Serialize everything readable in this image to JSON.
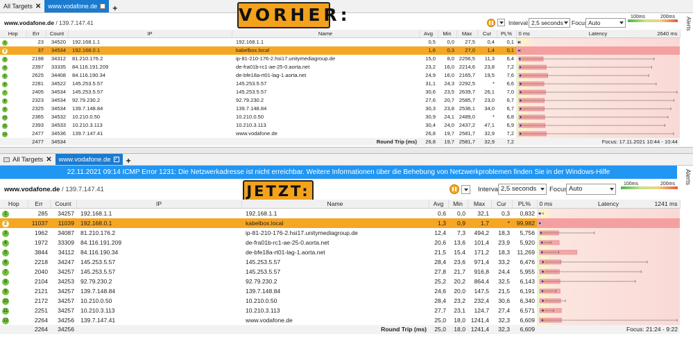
{
  "tabs": {
    "all_targets": "All Targets",
    "active": "www.vodafone.de"
  },
  "colors": {
    "accent": "#1a7bd0",
    "highlight": "#f5a623",
    "banner": "#f2a21c",
    "error_bar": "#2196f3",
    "hop_badge": "#76c043"
  },
  "panels": [
    {
      "banner": "VORHER:",
      "target_name": "www.vodafone.de",
      "target_ip": " / 139.7.147.41",
      "interval_label": "Interval",
      "interval_value": "2,5 seconds",
      "focus_label": "Focus",
      "focus_value": "Auto",
      "legend_100": "100ms",
      "legend_200": "200ms",
      "alerts_label": "Alerts",
      "headers": {
        "hop": "Hop",
        "err": "Err",
        "count": "Count",
        "ip": "IP",
        "name": "Name",
        "avg": "Avg",
        "min": "Min",
        "max": "Max",
        "cur": "Cur",
        "pl": "PL%",
        "zero": "0 ms",
        "latency": "Latency",
        "scale": "2640 ms"
      },
      "rows": [
        {
          "hop": "1",
          "err": "23",
          "count": "34520",
          "ip": "192.168.1.1",
          "name": "192.168.1.1",
          "avg": "0,5",
          "min": "0,0",
          "max": "27,5",
          "cur": "0,4",
          "pl": "0,1"
        },
        {
          "hop": "2",
          "err": "37",
          "count": "34534",
          "ip": "192.168.0.1",
          "name": "kabelbox.local",
          "avg": "1,6",
          "min": "0,3",
          "max": "27,0",
          "cur": "1,4",
          "pl": "0,1"
        },
        {
          "hop": "3",
          "err": "2198",
          "count": "34312",
          "ip": "81.210.176.2",
          "name": "ip-81-210-176-2.hsi17.unitymediagroup.de",
          "avg": "15,0",
          "min": "8,0",
          "max": "2256,5",
          "cur": "11,3",
          "pl": "6,4"
        },
        {
          "hop": "4",
          "err": "2397",
          "count": "33335",
          "ip": "84.116.191.209",
          "name": "de-fra01b-rc1-ae-25-0.aorta.net",
          "avg": "23,2",
          "min": "16,0",
          "max": "2214,6",
          "cur": "23,8",
          "pl": "7,2"
        },
        {
          "hop": "5",
          "err": "2625",
          "count": "34408",
          "ip": "84.116.190.34",
          "name": "de-bfe18a-rt01-lag-1.aorta.net",
          "avg": "24,9",
          "min": "16,0",
          "max": "2165,7",
          "cur": "19,5",
          "pl": "7,6"
        },
        {
          "hop": "6",
          "err": "2281",
          "count": "34522",
          "ip": "145.253.5.57",
          "name": "145.253.5.57",
          "avg": "31,1",
          "min": "24,3",
          "max": "2292,5",
          "cur": "*",
          "pl": "6,6"
        },
        {
          "hop": "7",
          "err": "2405",
          "count": "34534",
          "ip": "145.253.5.57",
          "name": "145.253.5.57",
          "avg": "30,6",
          "min": "23,5",
          "max": "2639,7",
          "cur": "26,1",
          "pl": "7,0"
        },
        {
          "hop": "8",
          "err": "2323",
          "count": "34534",
          "ip": "92.79.230.2",
          "name": "92.79.230.2",
          "avg": "27,6",
          "min": "20,7",
          "max": "2585,7",
          "cur": "23,0",
          "pl": "6,7"
        },
        {
          "hop": "9",
          "err": "2325",
          "count": "34534",
          "ip": "139.7.148.84",
          "name": "139.7.148.84",
          "avg": "30,3",
          "min": "23,8",
          "max": "2536,1",
          "cur": "34,0",
          "pl": "6,7"
        },
        {
          "hop": "10",
          "err": "2365",
          "count": "34532",
          "ip": "10.210.0.50",
          "name": "10.210.0.50",
          "avg": "30,9",
          "min": "24,1",
          "max": "2489,0",
          "cur": "*",
          "pl": "6,8"
        },
        {
          "hop": "11",
          "err": "2393",
          "count": "34533",
          "ip": "10.210.3.113",
          "name": "10.210.3.113",
          "avg": "30,4",
          "min": "24,0",
          "max": "2437,2",
          "cur": "47,1",
          "pl": "6,9"
        },
        {
          "hop": "12",
          "err": "2477",
          "count": "34536",
          "ip": "139.7.147.41",
          "name": "www.vodafone.de",
          "avg": "26,8",
          "min": "19,7",
          "max": "2581,7",
          "cur": "32,9",
          "pl": "7,2"
        }
      ],
      "total": {
        "err": "2477",
        "count": "34534",
        "label": "Round Trip (ms)",
        "avg": "26,8",
        "min": "19,7",
        "max": "2581,7",
        "cur": "32,9",
        "pl": "7,2",
        "focus": "Focus: 17.11.2021 10:44 - 10:44"
      }
    },
    {
      "banner": "JETZT:",
      "error_message": "22.11.2021 09:14 ICMP Error 1231: Die Netzwerkadresse ist nicht erreichbar. Weitere Informationen über die Behebung von Netzwerkproblemen finden Sie in der Windows-Hilfe",
      "target_name": "www.vodafone.de",
      "target_ip": " / 139.7.147.41",
      "interval_label": "Interval",
      "interval_value": "2,5 seconds",
      "focus_label": "Focus",
      "focus_value": "Auto",
      "legend_100": "100ms",
      "legend_200": "200ms",
      "alerts_label": "Alerts",
      "headers": {
        "hop": "Hop",
        "err": "Err",
        "count": "Count",
        "ip": "IP",
        "name": "Name",
        "avg": "Avg",
        "min": "Min",
        "max": "Max",
        "cur": "Cur",
        "pl": "PL%",
        "zero": "0 ms",
        "latency": "Latency",
        "scale": "1241 ms"
      },
      "rows": [
        {
          "hop": "1",
          "err": "285",
          "count": "34257",
          "ip": "192.168.1.1",
          "name": "192.168.1.1",
          "avg": "0,6",
          "min": "0,0",
          "max": "32,1",
          "cur": "0,3",
          "pl": "0,832"
        },
        {
          "hop": "2",
          "err": "11037",
          "count": "11039",
          "ip": "192.168.0.1",
          "name": "kabelbox.local",
          "avg": "1,3",
          "min": "0,9",
          "max": "1,7",
          "cur": "*",
          "pl": "99,982"
        },
        {
          "hop": "3",
          "err": "1962",
          "count": "34087",
          "ip": "81.210.176.2",
          "name": "ip-81-210-176-2.hsi17.unitymediagroup.de",
          "avg": "12,4",
          "min": "7,3",
          "max": "494,2",
          "cur": "18,3",
          "pl": "5,756"
        },
        {
          "hop": "4",
          "err": "1972",
          "count": "33309",
          "ip": "84.116.191.209",
          "name": "de-fra01b-rc1-ae-25-0.aorta.net",
          "avg": "20,6",
          "min": "13,6",
          "max": "101,4",
          "cur": "23,9",
          "pl": "5,920"
        },
        {
          "hop": "5",
          "err": "3844",
          "count": "34112",
          "ip": "84.116.190.34",
          "name": "de-bfe18a-rt01-lag-1.aorta.net",
          "avg": "21,5",
          "min": "15,4",
          "max": "171,2",
          "cur": "18,3",
          "pl": "11,269"
        },
        {
          "hop": "6",
          "err": "2218",
          "count": "34247",
          "ip": "145.253.5.57",
          "name": "145.253.5.57",
          "avg": "28,4",
          "min": "23,6",
          "max": "971,4",
          "cur": "33,2",
          "pl": "6,476"
        },
        {
          "hop": "7",
          "err": "2040",
          "count": "34257",
          "ip": "145.253.5.57",
          "name": "145.253.5.57",
          "avg": "27,8",
          "min": "21,7",
          "max": "916,8",
          "cur": "24,4",
          "pl": "5,955"
        },
        {
          "hop": "8",
          "err": "2104",
          "count": "34253",
          "ip": "92.79.230.2",
          "name": "92.79.230.2",
          "avg": "25,2",
          "min": "20,2",
          "max": "864,4",
          "cur": "32,5",
          "pl": "6,143"
        },
        {
          "hop": "9",
          "err": "2121",
          "count": "34257",
          "ip": "139.7.148.84",
          "name": "139.7.148.84",
          "avg": "24,6",
          "min": "20,0",
          "max": "147,5",
          "cur": "21,5",
          "pl": "6,191"
        },
        {
          "hop": "10",
          "err": "2172",
          "count": "34257",
          "ip": "10.210.0.50",
          "name": "10.210.0.50",
          "avg": "28,4",
          "min": "23,2",
          "max": "232,4",
          "cur": "30,6",
          "pl": "6,340"
        },
        {
          "hop": "11",
          "err": "2251",
          "count": "34257",
          "ip": "10.210.3.113",
          "name": "10.210.3.113",
          "avg": "27,7",
          "min": "23,1",
          "max": "124,7",
          "cur": "27,4",
          "pl": "6,571"
        },
        {
          "hop": "12",
          "err": "2264",
          "count": "34256",
          "ip": "139.7.147.41",
          "name": "www.vodafone.de",
          "avg": "25,0",
          "min": "18,0",
          "max": "1241,4",
          "cur": "32,3",
          "pl": "6,609"
        }
      ],
      "total": {
        "err": "2264",
        "count": "34256",
        "label": "Round Trip (ms)",
        "avg": "25,0",
        "min": "18,0",
        "max": "1241,4",
        "cur": "32,3",
        "pl": "6,609",
        "focus": "Focus: 21:24 - 9:22"
      }
    }
  ]
}
